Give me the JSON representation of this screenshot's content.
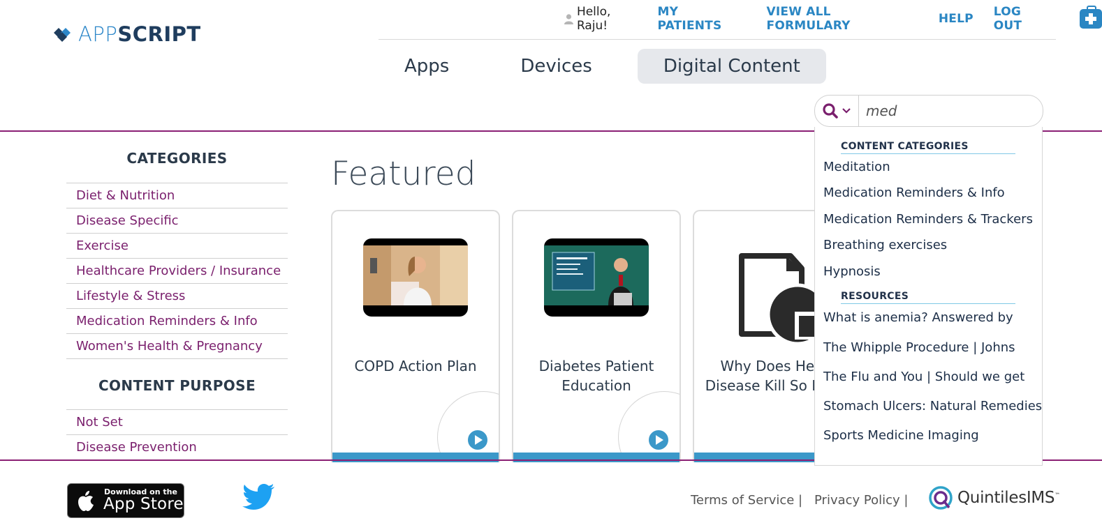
{
  "brand": {
    "name_thin": "APP",
    "name_bold": "SCRIPT"
  },
  "topnav": {
    "greeting": "Hello, Raju!",
    "links": [
      "MY PATIENTS",
      "VIEW ALL FORMULARY",
      "HELP",
      "LOG OUT"
    ]
  },
  "tabs": [
    "Apps",
    "Devices",
    "Digital Content"
  ],
  "active_tab": "Digital Content",
  "search": {
    "value": "med"
  },
  "sidebar": {
    "categories_heading": "CATEGORIES",
    "categories": [
      "Diet & Nutrition",
      "Disease Specific",
      "Exercise",
      "Healthcare Providers / Insurance",
      "Lifestyle & Stress",
      "Medication Reminders & Info",
      "Women's Health & Pregnancy"
    ],
    "purpose_heading": "CONTENT PURPOSE",
    "purposes": [
      "Not Set",
      "Disease Prevention"
    ]
  },
  "featured": {
    "heading": "Featured",
    "cards": [
      {
        "title": "COPD Action Plan",
        "thumb": "doctor-video-thumbnail"
      },
      {
        "title": "Diabetes Patient Education",
        "thumb": "presenter-video-thumbnail"
      },
      {
        "title": "Why Does Heart Disease Kill So Many",
        "thumb": "document-icon"
      }
    ]
  },
  "dropdown": {
    "content_heading": "CONTENT CATEGORIES",
    "content_items": [
      "Meditation",
      "Medication Reminders & Info",
      "Medication Reminders & Trackers",
      "Breathing exercises",
      "Hypnosis"
    ],
    "resources_heading": "RESOURCES",
    "resource_items": [
      "What is anemia? Answered by",
      "The Whipple Procedure | Johns",
      "The Flu and You | Should we get",
      "Stomach Ulcers: Natural Remedies",
      "Sports Medicine Imaging"
    ]
  },
  "footer": {
    "appstore_small": "Download on the",
    "appstore_big": "App Store",
    "terms": "Terms of Service |",
    "privacy": "Privacy Policy |",
    "partner": "QuintilesIMS",
    "partner_mark": "™"
  },
  "colors": {
    "accent_blue": "#2a86c3",
    "purple": "#7a1f6d",
    "card_bar": "#3b98c9"
  }
}
